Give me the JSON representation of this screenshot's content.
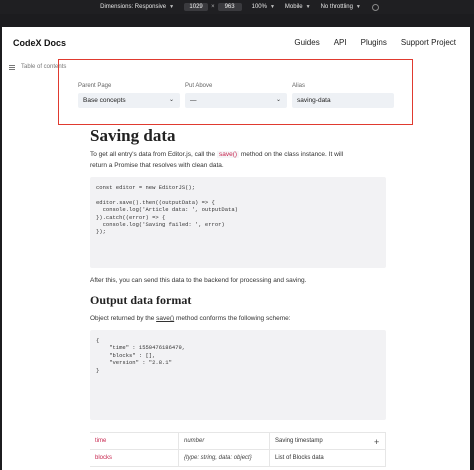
{
  "devtools": {
    "dimensions_label": "Dimensions: Responsive",
    "width": "1029",
    "height": "963",
    "zoom": "100%",
    "device": "Mobile",
    "throttle": "No throttling"
  },
  "header": {
    "brand": "CodeX Docs",
    "nav": [
      "Guides",
      "API",
      "Plugins",
      "Support Project"
    ]
  },
  "toc": {
    "label": "Table of contents"
  },
  "form": {
    "parent_label": "Parent Page",
    "parent_value": "Base concepts",
    "above_label": "Put Above",
    "above_value": "—",
    "alias_label": "Alias",
    "alias_value": "saving-data"
  },
  "article": {
    "title": "Saving data",
    "intro_1": "To get all entry's data from Editor.js, call the",
    "intro_code": "save()",
    "intro_2": "method on the class instance. It will",
    "intro_3": "return a Promise that resolves with clean data.",
    "code1": "const editor = new EditorJS();\n\neditor.save().then((outputData) => {\n  console.log('Article data: ', outputData)\n}).catch((error) => {\n  console.log('Saving failed: ', error)\n});",
    "after": "After this, you can send this data to the backend for processing and saving.",
    "h2": "Output data format",
    "desc_1": "Object returned by the",
    "desc_link": "save()",
    "desc_2": "method conforms the following scheme:",
    "code2": "{\n    \"time\" : 1550476186479,\n    \"blocks\" : [],\n    \"version\" : \"2.8.1\"\n}",
    "table": [
      {
        "key": "time",
        "type": "number",
        "desc": "Saving timestamp"
      },
      {
        "key": "blocks",
        "type": "{type: string, data: object}",
        "desc": "List of Blocks data"
      }
    ],
    "plus": "+"
  }
}
